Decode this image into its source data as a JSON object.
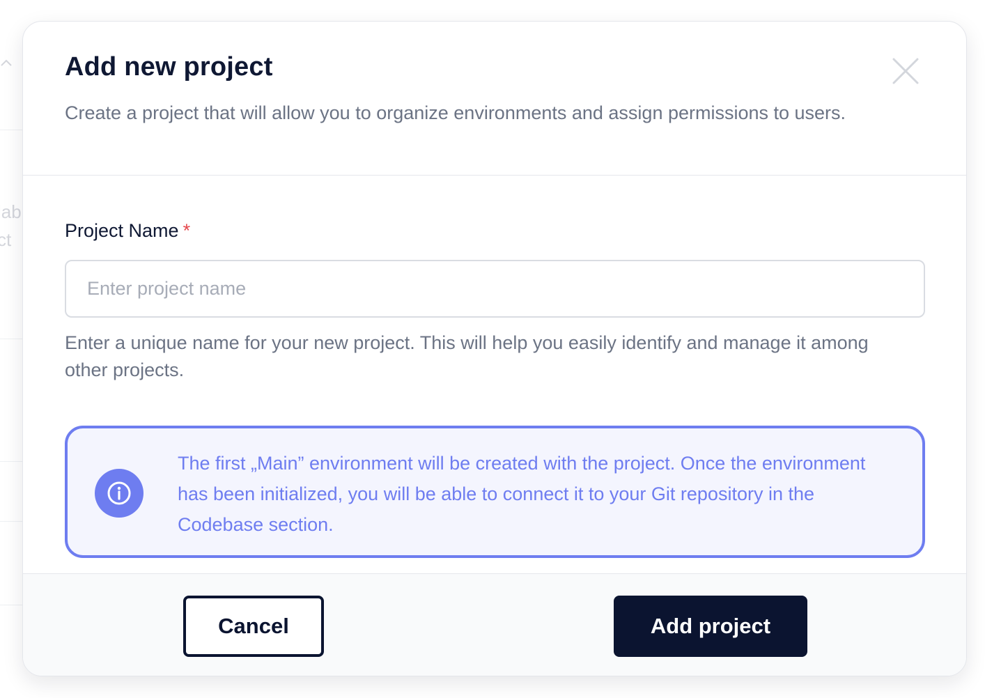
{
  "background": {
    "fragments": [
      "lab",
      "ct"
    ]
  },
  "modal": {
    "title": "Add new project",
    "subtitle": "Create a project that will allow you to organize environments and assign permissions to users.",
    "close_icon": "close-icon"
  },
  "form": {
    "name_label": "Project Name",
    "required_mark": "*",
    "name_value": "",
    "name_placeholder": "Enter project name",
    "help_text": "Enter a unique name for your new project. This will help you easily identify and manage it among other projects."
  },
  "info": {
    "icon": "info-icon",
    "text": "The first „Main” environment will be created with the project. Once the environment has been initialized, you will be able to connect it to your Git repository in the Codebase section."
  },
  "footer": {
    "cancel_label": "Cancel",
    "add_label": "Add project"
  },
  "colors": {
    "primary": "#0b1430",
    "accent": "#6e7df0",
    "required": "#e5484d"
  }
}
